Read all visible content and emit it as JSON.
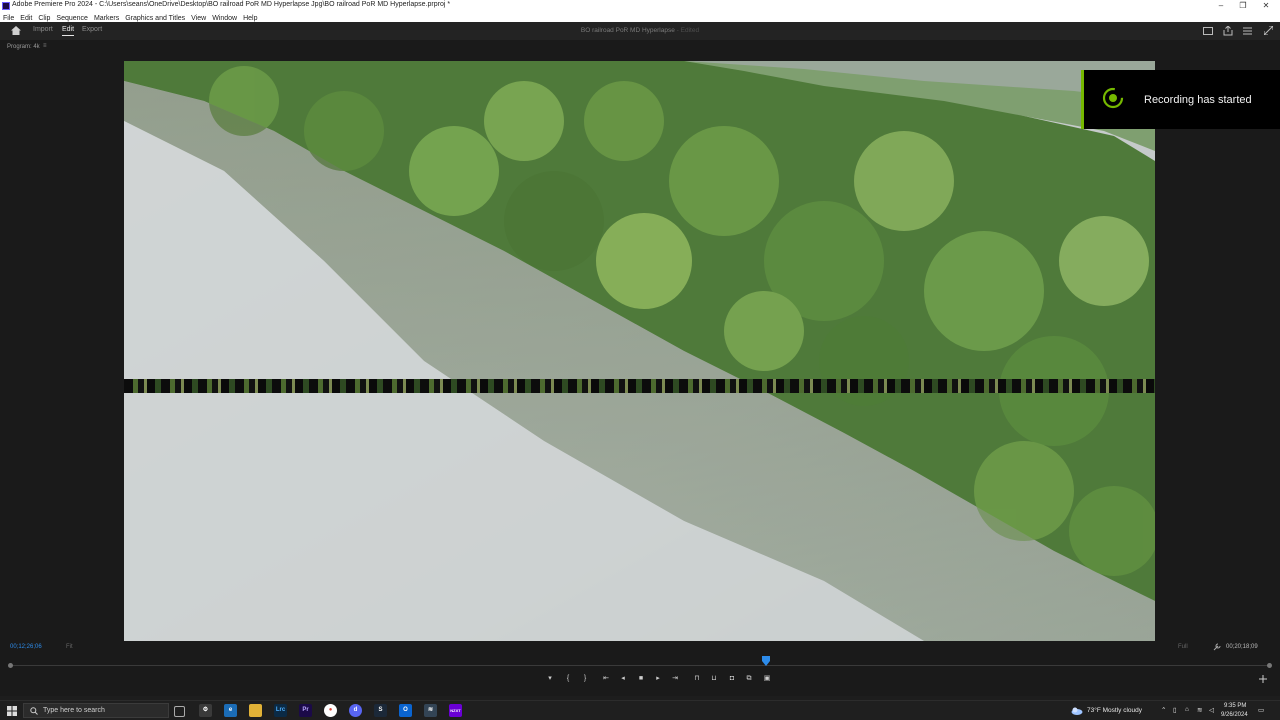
{
  "window": {
    "title": "Adobe Premiere Pro 2024 - C:\\Users\\seans\\OneDrive\\Desktop\\BO railroad PoR MD Hyperlapse Jpg\\BO railroad PoR MD Hyperlapse.prproj *",
    "controls": [
      "–",
      "❐",
      "✕"
    ]
  },
  "menu": [
    "File",
    "Edit",
    "Clip",
    "Sequence",
    "Markers",
    "Graphics and Titles",
    "View",
    "Window",
    "Help"
  ],
  "workspace": {
    "tabs": [
      {
        "label": "Import",
        "active": false
      },
      {
        "label": "Edit",
        "active": true
      },
      {
        "label": "Export",
        "active": false
      }
    ],
    "project_title": "BO railroad PoR MD Hyperlapse",
    "project_status": "- Edited"
  },
  "program_monitor": {
    "label": "Program: 4k",
    "current_timecode": "00;12;26;06",
    "fit": "Fit",
    "resolution": "Full",
    "duration_timecode": "00;20;18;09",
    "playhead_progress": 0.6
  },
  "notification": {
    "text": "Recording has started",
    "accent": "#76b900"
  },
  "transport_buttons": [
    {
      "name": "add-marker",
      "glyph": "▾"
    },
    {
      "name": "mark-in",
      "glyph": "{"
    },
    {
      "name": "mark-out",
      "glyph": "}"
    },
    {
      "name": "go-to-in",
      "glyph": "⇤"
    },
    {
      "name": "step-back",
      "glyph": "◂"
    },
    {
      "name": "stop",
      "glyph": "■"
    },
    {
      "name": "step-forward",
      "glyph": "▸"
    },
    {
      "name": "go-to-out",
      "glyph": "⇥"
    },
    {
      "name": "lift",
      "glyph": "⊓"
    },
    {
      "name": "extract",
      "glyph": "⊔"
    },
    {
      "name": "export-frame",
      "glyph": "◘"
    },
    {
      "name": "comparison-view",
      "glyph": "⧉"
    },
    {
      "name": "multicam",
      "glyph": "▣"
    }
  ],
  "taskbar": {
    "search_placeholder": "Type here to search",
    "apps": [
      "Task View",
      "Settings",
      "Edge",
      "File Explorer",
      "Lrc",
      "Pr",
      "Chrome",
      "Discord",
      "Steam",
      "Outlook",
      "Afterburner",
      "NZXT"
    ],
    "weather": "73°F  Mostly cloudy",
    "time": "9:35 PM",
    "date": "9/26/2024"
  }
}
